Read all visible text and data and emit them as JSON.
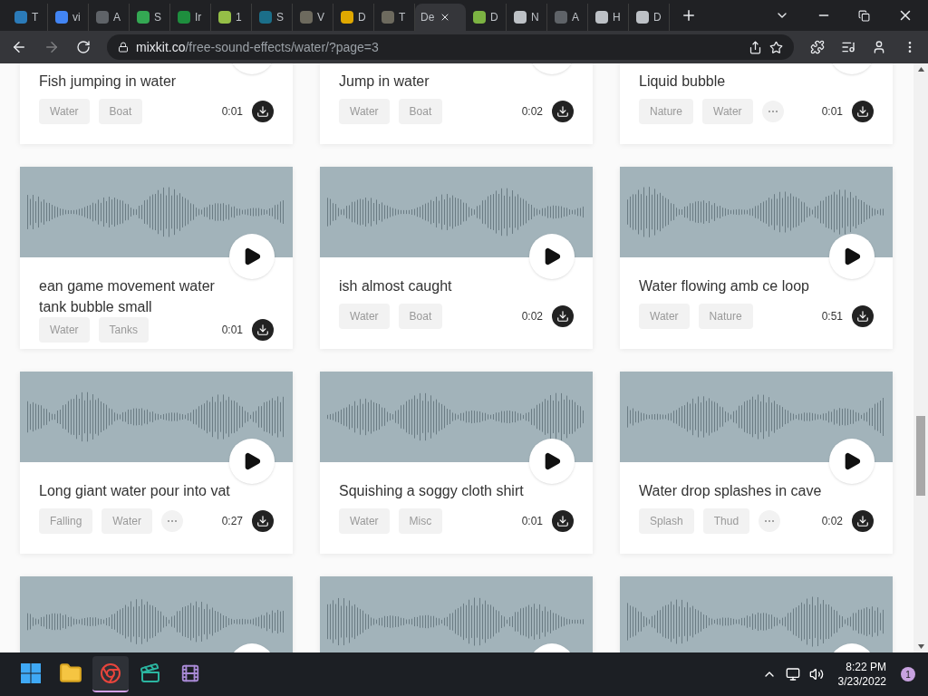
{
  "tabs": [
    {
      "label": "T",
      "selected": false,
      "color": "#2b7bb9"
    },
    {
      "label": "vi",
      "selected": false,
      "color": "#4285f4"
    },
    {
      "label": "A",
      "selected": false,
      "color": "#5f6368"
    },
    {
      "label": "S",
      "selected": false,
      "color": "#34a853"
    },
    {
      "label": "Ir",
      "selected": false,
      "color": "#1e8e3e"
    },
    {
      "label": "1",
      "selected": false,
      "color": "#95bf47"
    },
    {
      "label": "S",
      "selected": false,
      "color": "#1b6f8a"
    },
    {
      "label": "V",
      "selected": false,
      "color": "#6d6a5e"
    },
    {
      "label": "D",
      "selected": false,
      "color": "#e0a800"
    },
    {
      "label": "T",
      "selected": false,
      "color": "#6d6a5e"
    },
    {
      "label": "De",
      "selected": true
    },
    {
      "label": "D",
      "selected": false,
      "color": "#7cb342"
    },
    {
      "label": "N",
      "selected": false,
      "color": "#bdc1c6"
    },
    {
      "label": "A",
      "selected": false,
      "color": "#5f6368"
    },
    {
      "label": "H",
      "selected": false,
      "color": "#bdc1c6"
    },
    {
      "label": "D",
      "selected": false,
      "color": "#bdc1c6"
    }
  ],
  "address": {
    "domain": "mixkit.co",
    "path": "/free-sound-effects/water/?page=3"
  },
  "cards": [
    {
      "kind": "full",
      "title": "Fish jumping in water",
      "tags": [
        "Water",
        "Boat"
      ],
      "has_more": false,
      "duration": "0:01"
    },
    {
      "kind": "full",
      "title": "Jump in water",
      "tags": [
        "Water",
        "Boat"
      ],
      "has_more": false,
      "duration": "0:02"
    },
    {
      "kind": "full",
      "title": "Liquid bubble",
      "tags": [
        "Nature",
        "Water"
      ],
      "has_more": true,
      "duration": "0:01"
    },
    {
      "kind": "full",
      "title": "ean game movement water tank bubble small",
      "tags": [
        "Water",
        "Tanks"
      ],
      "has_more": false,
      "duration": "0:01"
    },
    {
      "kind": "full",
      "title": "ish almost caught",
      "tags": [
        "Water",
        "Boat"
      ],
      "has_more": false,
      "duration": "0:02"
    },
    {
      "kind": "full",
      "title": "Water flowing amb ce loop",
      "tags": [
        "Water",
        "Nature"
      ],
      "has_more": false,
      "duration": "0:51"
    },
    {
      "kind": "full",
      "title": "Long giant water pour into vat",
      "tags": [
        "Falling",
        "Water"
      ],
      "has_more": true,
      "duration": "0:27"
    },
    {
      "kind": "full",
      "title": "Squishing a soggy cloth shirt",
      "tags": [
        "Water",
        "Misc"
      ],
      "has_more": false,
      "duration": "0:01"
    },
    {
      "kind": "full",
      "title": "Water drop splashes in cave",
      "tags": [
        "Splash",
        "Thud"
      ],
      "has_more": true,
      "duration": "0:02"
    },
    {
      "kind": "cut_off"
    },
    {
      "kind": "cut_off"
    },
    {
      "kind": "cut_off"
    }
  ],
  "taskbar": {
    "apps": [
      {
        "selected": false
      },
      {
        "selected": false
      },
      {
        "selected": true
      },
      {
        "selected": false
      },
      {
        "selected": false
      }
    ],
    "time": "8:22 PM",
    "date": "3/23/2022",
    "notifications": "1"
  }
}
